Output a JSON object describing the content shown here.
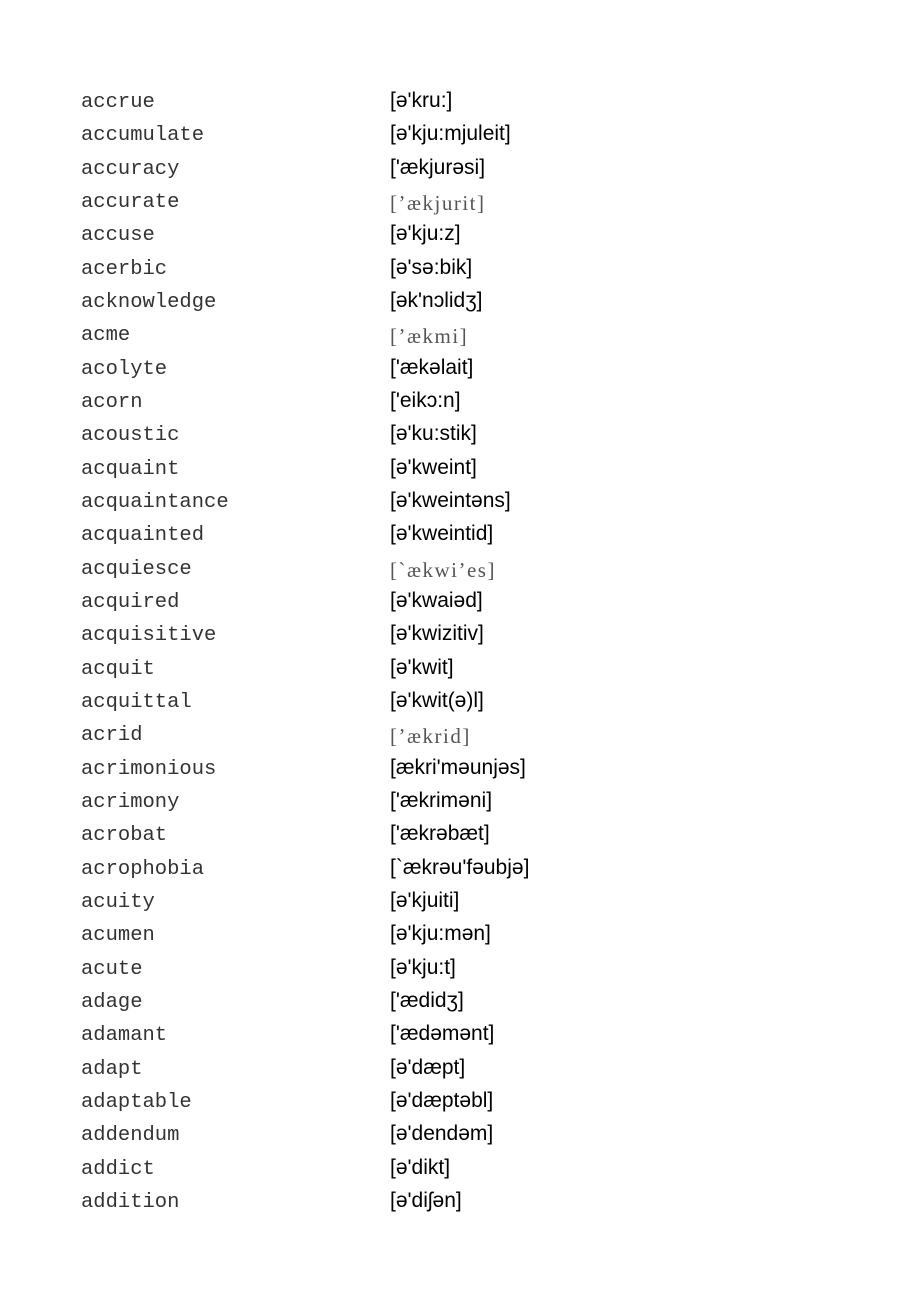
{
  "entries": [
    {
      "word": "accrue",
      "pron": "[ə'kru:]",
      "style": "sans"
    },
    {
      "word": "accumulate",
      "pron": "[ə'kju:mjuleit]",
      "style": "sans"
    },
    {
      "word": "accuracy",
      "pron": "['ækjurəsi]",
      "style": "sans"
    },
    {
      "word": "accurate",
      "pron": "[’ækjurit]",
      "style": "serif"
    },
    {
      "word": "accuse",
      "pron": "[ə'kju:z]",
      "style": "sans"
    },
    {
      "word": "acerbic",
      "pron": "[ə'sə:bik]",
      "style": "sans"
    },
    {
      "word": "acknowledge",
      "pron": "[ək'nɔlidʒ]",
      "style": "sans"
    },
    {
      "word": "acme",
      "pron": "[’ækmi]",
      "style": "serif"
    },
    {
      "word": "acolyte",
      "pron": "['ækəlait]",
      "style": "sans"
    },
    {
      "word": "acorn",
      "pron": "['eikɔ:n]",
      "style": "sans"
    },
    {
      "word": "acoustic",
      "pron": "[ə'ku:stik]",
      "style": "sans"
    },
    {
      "word": "acquaint",
      "pron": "[ə'kweint]",
      "style": "sans"
    },
    {
      "word": "acquaintance",
      "pron": "[ə'kweintəns]",
      "style": "sans"
    },
    {
      "word": "acquainted",
      "pron": "[ə'kweintid]",
      "style": "sans"
    },
    {
      "word": "acquiesce",
      "pron": "[`ækwi’es]",
      "style": "serif"
    },
    {
      "word": "acquired",
      "pron": "[ə'kwaiəd]",
      "style": "sans"
    },
    {
      "word": "acquisitive",
      "pron": "[ə'kwizitiv]",
      "style": "sans"
    },
    {
      "word": "acquit",
      "pron": "[ə'kwit]",
      "style": "sans"
    },
    {
      "word": "acquittal",
      "pron": "[ə'kwit(ə)l]",
      "style": "sans"
    },
    {
      "word": "acrid",
      "pron": "[’ækrid]",
      "style": "serif"
    },
    {
      "word": "acrimonious",
      "pron": "[ækri'məunjəs]",
      "style": "sans"
    },
    {
      "word": "acrimony",
      "pron": "['ækriməni]",
      "style": "sans"
    },
    {
      "word": "acrobat",
      "pron": "['ækrəbæt]",
      "style": "sans"
    },
    {
      "word": "acrophobia",
      "pron": "[`ækrəu'fəubjə]",
      "style": "sans"
    },
    {
      "word": "acuity",
      "pron": "[ə'kjuiti]",
      "style": "sans"
    },
    {
      "word": "acumen",
      "pron": "[ə'kju:mən]",
      "style": "sans"
    },
    {
      "word": "acute",
      "pron": "[ə'kju:t]",
      "style": "sans"
    },
    {
      "word": "adage",
      "pron": "['ædidʒ]",
      "style": "sans"
    },
    {
      "word": "adamant",
      "pron": "['ædəmənt]",
      "style": "sans"
    },
    {
      "word": "adapt",
      "pron": "[ə'dæpt]",
      "style": "sans"
    },
    {
      "word": "adaptable",
      "pron": "[ə'dæptəbl]",
      "style": "sans"
    },
    {
      "word": "addendum",
      "pron": "[ə'dendəm]",
      "style": "sans"
    },
    {
      "word": "addict",
      "pron": "[ə'dikt]",
      "style": "sans"
    },
    {
      "word": "addition",
      "pron": "[ə'diʃən]",
      "style": "sans"
    }
  ]
}
